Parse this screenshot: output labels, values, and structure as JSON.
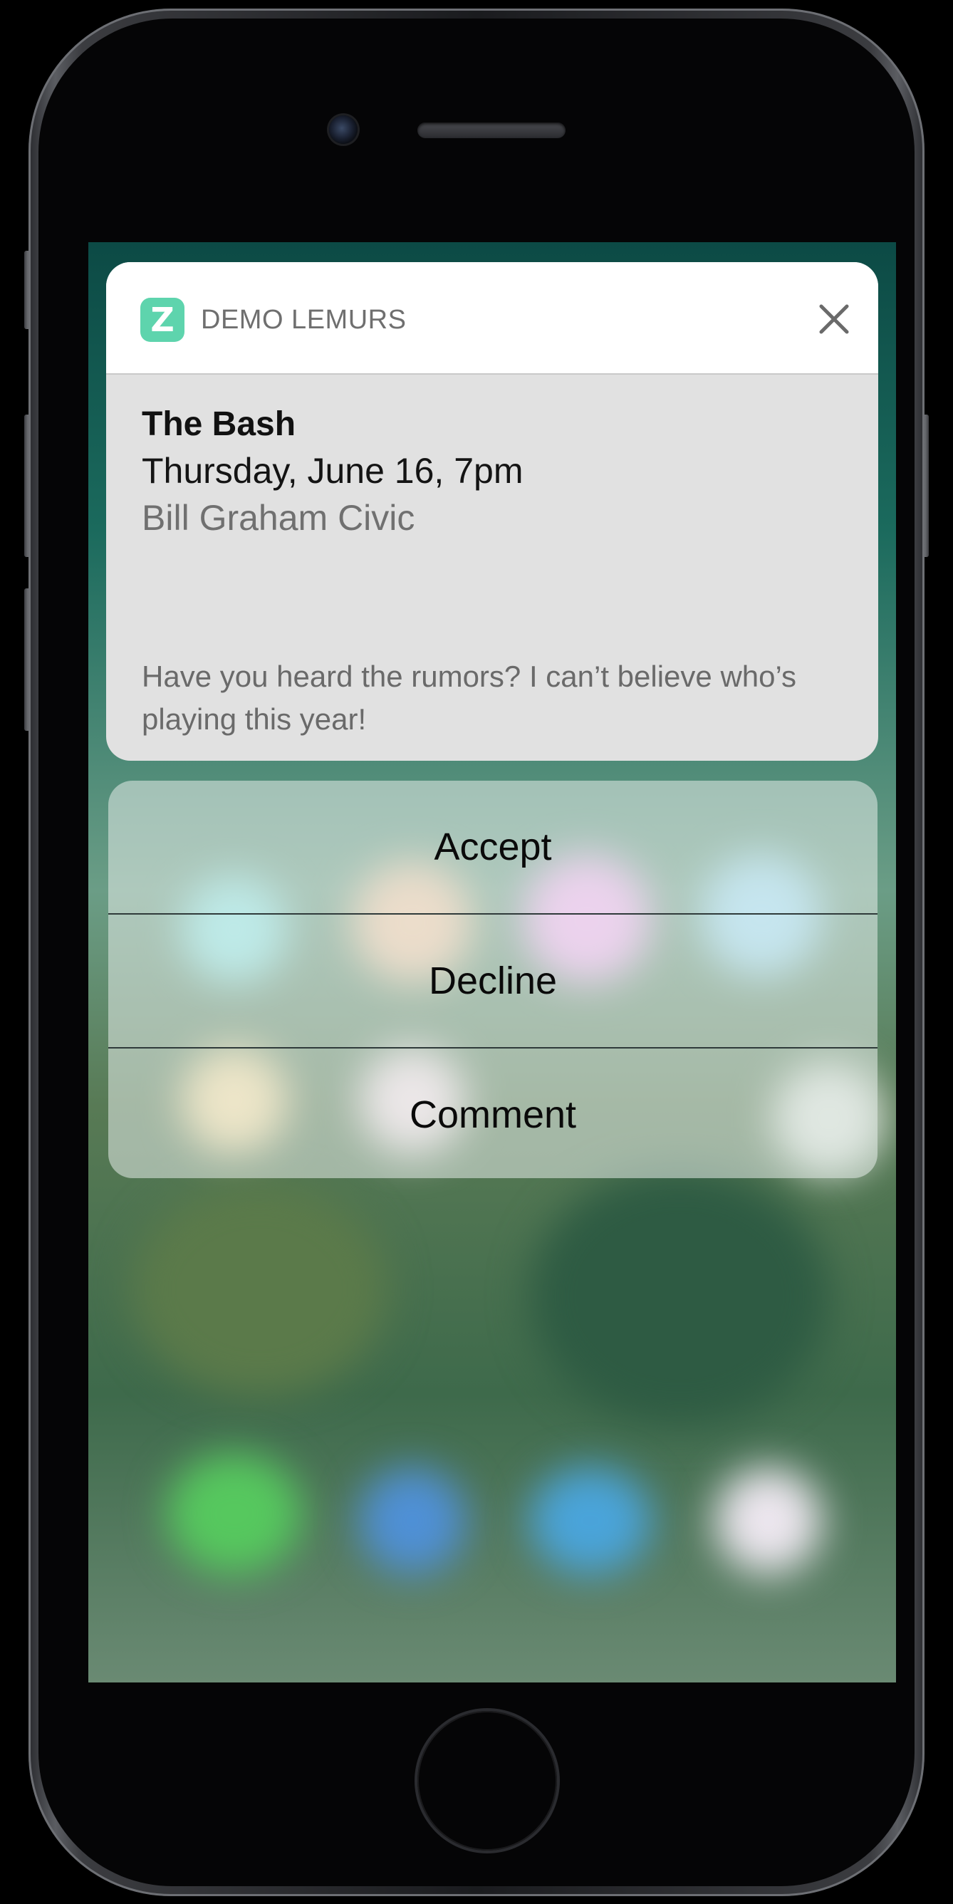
{
  "notification": {
    "app_icon_letter": "Z",
    "app_name": "DEMO LEMURS",
    "close_icon": "close-icon",
    "title": "The Bash",
    "date_time": "Thursday, June 16, 7pm",
    "venue": "Bill Graham Civic",
    "message": "Have you heard the rumors? I can’t believe who’s playing this year!"
  },
  "actions": [
    {
      "label": "Accept"
    },
    {
      "label": "Decline"
    },
    {
      "label": "Comment"
    }
  ],
  "colors": {
    "app_icon": "#5ed4ad",
    "header_bg": "#ffffff",
    "body_bg": "#e1e1e1"
  }
}
